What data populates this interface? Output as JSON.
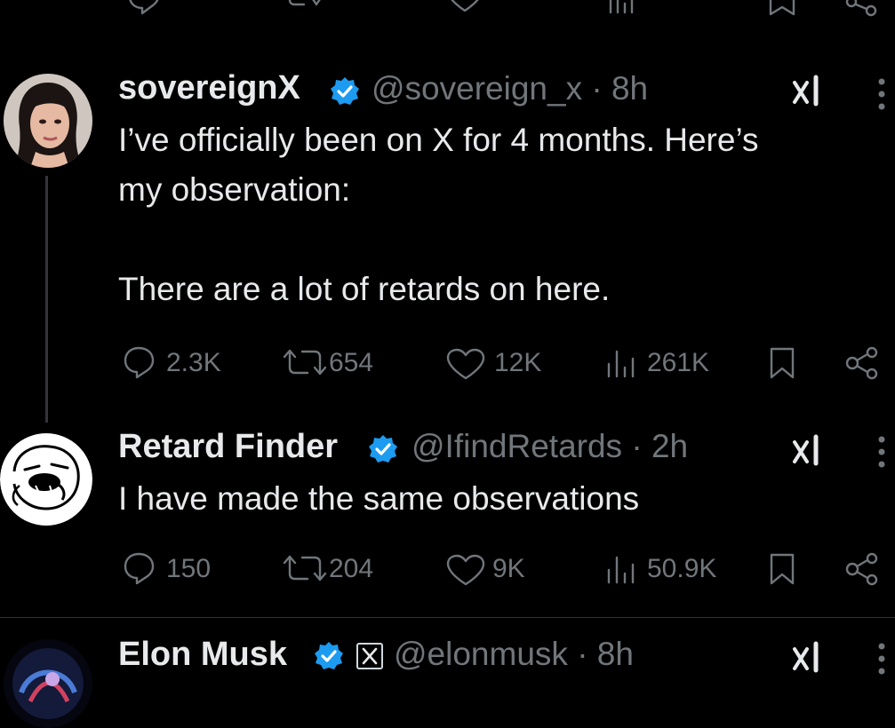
{
  "top_action_bar": {
    "icons": [
      "reply-icon",
      "repost-icon",
      "like-icon",
      "views-icon",
      "bookmark-icon",
      "share-icon"
    ]
  },
  "tweets": [
    {
      "display_name": "sovereignX",
      "handle": "@sovereign_x",
      "time": "· 8h",
      "body_line1": "I’ve officially been on X for 4 months. Here’s",
      "body_line2": "my observation:",
      "body_line3": "There are a lot of retards on here.",
      "replies": "2.3K",
      "reposts": "654",
      "likes": "12K",
      "views": "261K"
    },
    {
      "display_name": "Retard Finder",
      "handle": "@IfindRetards",
      "time": "· 2h",
      "body_line1": "I have made the same observations",
      "replies": "150",
      "reposts": "204",
      "likes": "9K",
      "views": "50.9K"
    },
    {
      "display_name": "Elon Musk",
      "handle": "@elonmusk",
      "time": "· 8h"
    }
  ],
  "colors": {
    "background": "#000000",
    "text_primary": "#e7e9ea",
    "text_secondary": "#71767b",
    "verified_blue": "#1d9bf0"
  }
}
